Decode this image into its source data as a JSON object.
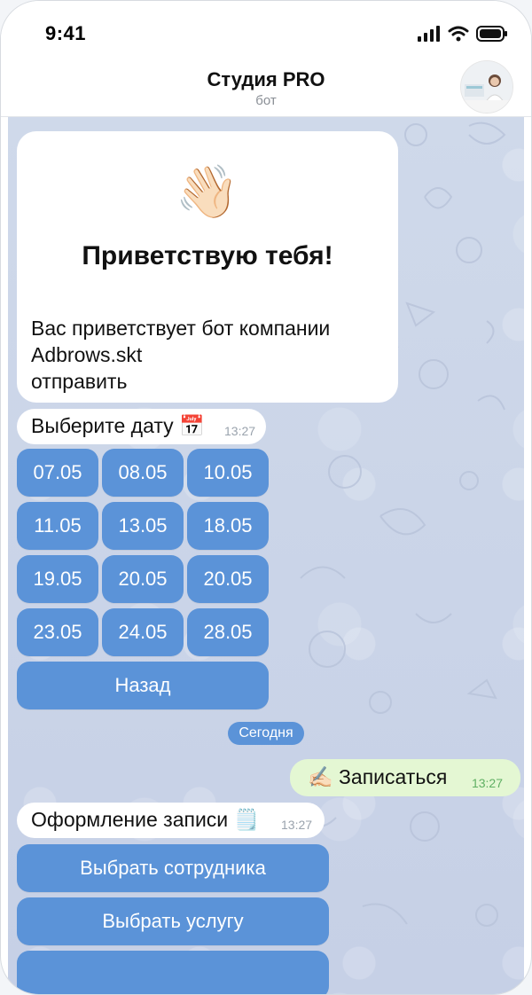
{
  "status": {
    "time": "9:41"
  },
  "header": {
    "title": "Студия PRO",
    "subtitle": "бот"
  },
  "welcome": {
    "emoji": "👋🏻",
    "heading": "Приветствую тебя!",
    "line1": "Вас приветствует бот компании",
    "line2": "Adbrows.skt",
    "line3": "отправить"
  },
  "date_message": {
    "text": "Выберите дату 📅",
    "time": "13:27"
  },
  "date_buttons": [
    "07.05",
    "08.05",
    "10.05",
    "11.05",
    "13.05",
    "18.05",
    "19.05",
    "20.05",
    "20.05",
    "23.05",
    "24.05",
    "28.05"
  ],
  "back_button": "Назад",
  "divider": "Сегодня",
  "outgoing": {
    "text": "✍🏻 Записаться",
    "time": "13:27"
  },
  "booking_message": {
    "text": "Оформление записи 🗒️",
    "time": "13:27"
  },
  "booking_buttons": [
    "Выбрать сотрудника",
    "Выбрать услугу",
    ""
  ],
  "colors": {
    "button": "#5b93d8",
    "chat_bg": "#ccd6e8",
    "outgoing_bg": "#e4f7d3"
  },
  "icons": [
    "signal-icon",
    "wifi-icon",
    "battery-icon"
  ]
}
